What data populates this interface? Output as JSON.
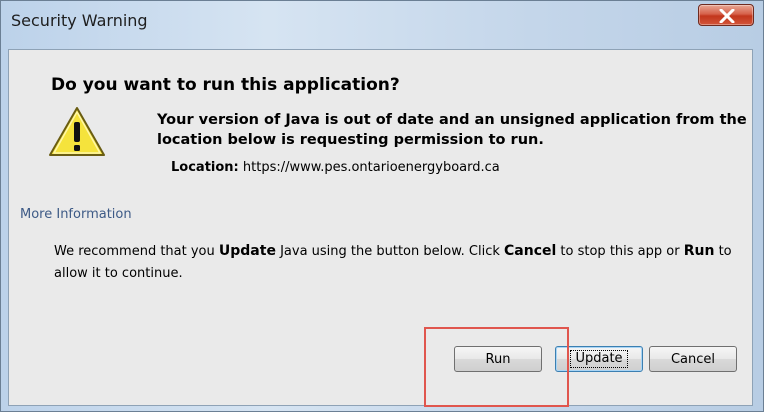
{
  "window": {
    "title": "Security Warning"
  },
  "dialog": {
    "heading": "Do you want to run this application?",
    "message": "Your version of Java is out of date and an unsigned application from the location below is requesting permission to run.",
    "location_label": "Location:",
    "location_value": "https://www.pes.ontarioenergyboard.ca",
    "more_info": "More Information",
    "recommend": {
      "part1": "We recommend that you ",
      "update_word": "Update",
      "part2": " Java using the button below. Click ",
      "cancel_word": "Cancel",
      "part3": " to stop this app or ",
      "run_word": "Run",
      "part4": " to allow it to continue."
    }
  },
  "buttons": {
    "run": "Run",
    "update": "Update",
    "cancel": "Cancel"
  },
  "icons": {
    "warning": "warning-triangle-icon",
    "close": "close-icon"
  },
  "colors": {
    "highlight": "#e0564e",
    "link": "#3d5a86",
    "close_button": "#c2361c",
    "warning_fill": "#f5e33c"
  }
}
